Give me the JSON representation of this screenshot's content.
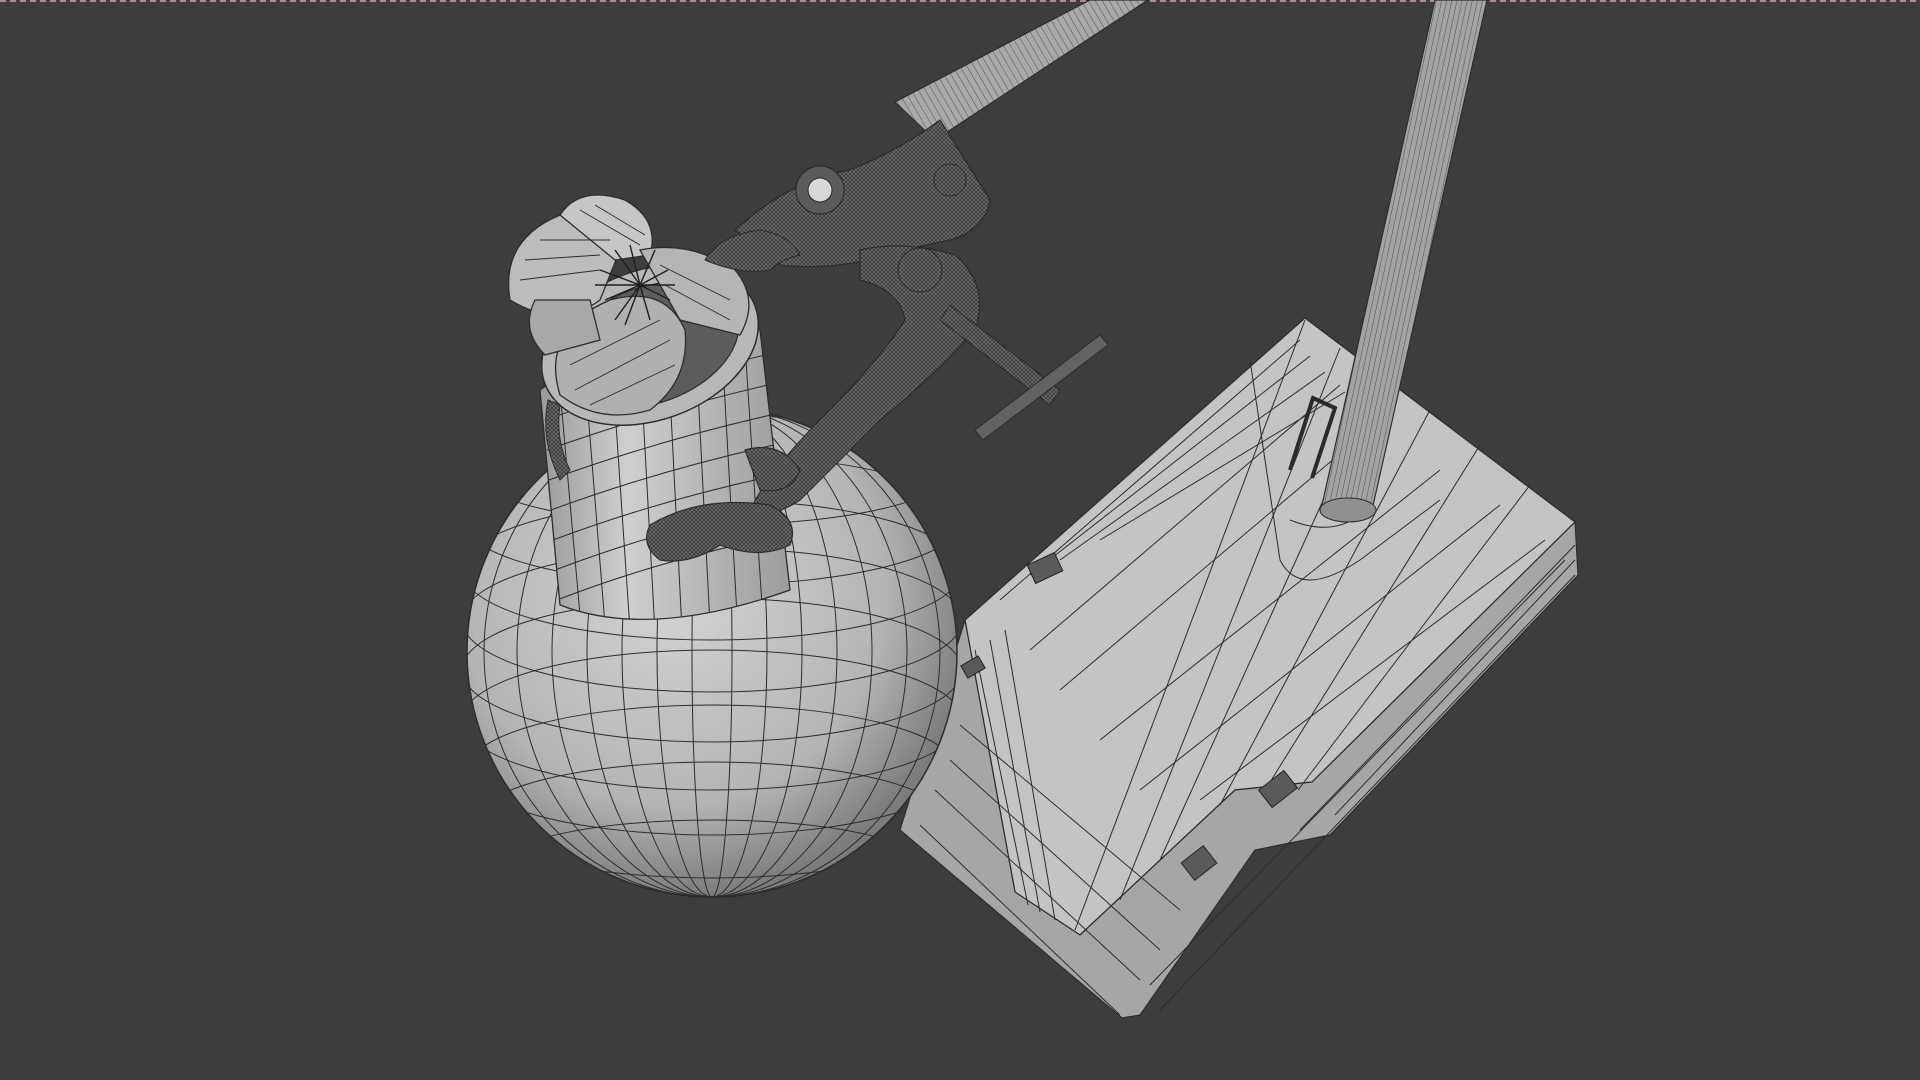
{
  "app": {
    "title": "",
    "view": "3D Viewport",
    "shading_mode": "wireframe-over-solid"
  },
  "colors": {
    "background": "#3d3d3d",
    "mesh_fill": "#bfbfbf",
    "mesh_shadow": "#8a8a8a",
    "wire": "#2c2c2c",
    "dense_wire": "#4a4a4a",
    "top_edge_marker": "#b9868c"
  },
  "scene": {
    "objects": [
      "flask",
      "flower",
      "clamp",
      "clamp-rod",
      "stand-rod",
      "stand-base"
    ]
  }
}
